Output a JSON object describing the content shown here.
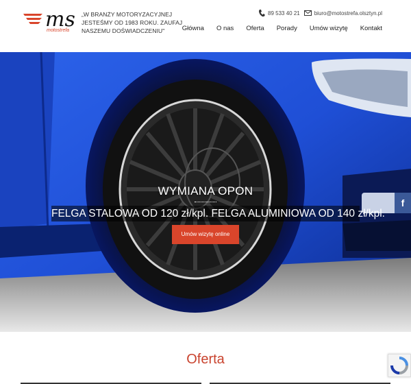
{
  "header": {
    "logo_text": "ms",
    "logo_sub": "motostrefa",
    "tagline": "„W BRANŻY MOTORYZACYJNEJ JESTEŚMY OD 1983 ROKU. ZAUFAJ NASZEMU DOŚWIADCZENIU\"",
    "phone": "89 533 40 21",
    "email": "biuro@motostrefa.olsztyn.pl"
  },
  "nav": {
    "items": [
      "Główna",
      "O nas",
      "Oferta",
      "Porady",
      "Umów wizytę",
      "Kontakt"
    ]
  },
  "hero": {
    "title": "WYMIANA OPON",
    "subtitle": "FELGA STALOWA OD 120 zł/kpl. FELGA ALUMINIOWA OD 140 zł/kpl.",
    "button_label": "Umów wizytę online"
  },
  "social": {
    "facebook_label": "f"
  },
  "section": {
    "title": "Oferta"
  },
  "colors": {
    "accent": "#d9452b",
    "title": "#c9432e",
    "car_blue": "#1f4fd6"
  }
}
